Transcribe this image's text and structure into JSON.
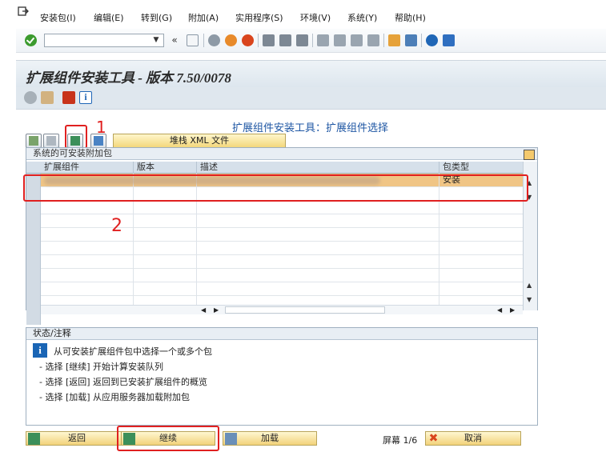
{
  "menu": {
    "items": [
      "安装包(I)",
      "编辑(E)",
      "转到(G)",
      "附加(A)",
      "实用程序(S)",
      "环境(V)",
      "系统(Y)",
      "帮助(H)"
    ]
  },
  "toolbar": {
    "command_value": "",
    "icons": [
      "enter-icon",
      "back-icon",
      "save-icon",
      "exit-icon",
      "cancel-icon",
      "print-icon",
      "find-icon",
      "find-next-icon",
      "first-page-icon",
      "prev-page-icon",
      "next-page-icon",
      "last-page-icon",
      "new-session-icon",
      "shortcut-icon",
      "help-icon",
      "customize-icon"
    ]
  },
  "title": "扩展组件安装工具 - 版本 7.50/0078",
  "screen": {
    "heading": "扩展组件安装工具：扩展组件选择",
    "xml_button": "堆栈 XML 文件",
    "annotation_1": "1",
    "annotation_2": "2",
    "table": {
      "group_title": "系统的可安装附加包",
      "columns": [
        "扩展组件",
        "版本",
        "描述",
        "包类型"
      ],
      "rows": [
        {
          "component": "",
          "version": "",
          "description": "",
          "package_type": "安装"
        }
      ]
    },
    "status": {
      "title": "状态/注释",
      "lines": [
        "从可安装扩展组件包中选择一个或多个包",
        "- 选择 [继续] 开始计算安装队列",
        "- 选择 [返回] 返回到已安装扩展组件的概览",
        "- 选择 [加载] 从应用服务器加载附加包"
      ]
    },
    "buttons": {
      "back": "返回",
      "continue": "继续",
      "load": "加载",
      "screen_label": "屏幕 1/6",
      "cancel": "取消"
    }
  },
  "colors": {
    "selected_row": "#f0c585",
    "annotation_red": "#e02020",
    "heading_blue": "#1f57a4",
    "button_yellow": "#f2d27a"
  }
}
